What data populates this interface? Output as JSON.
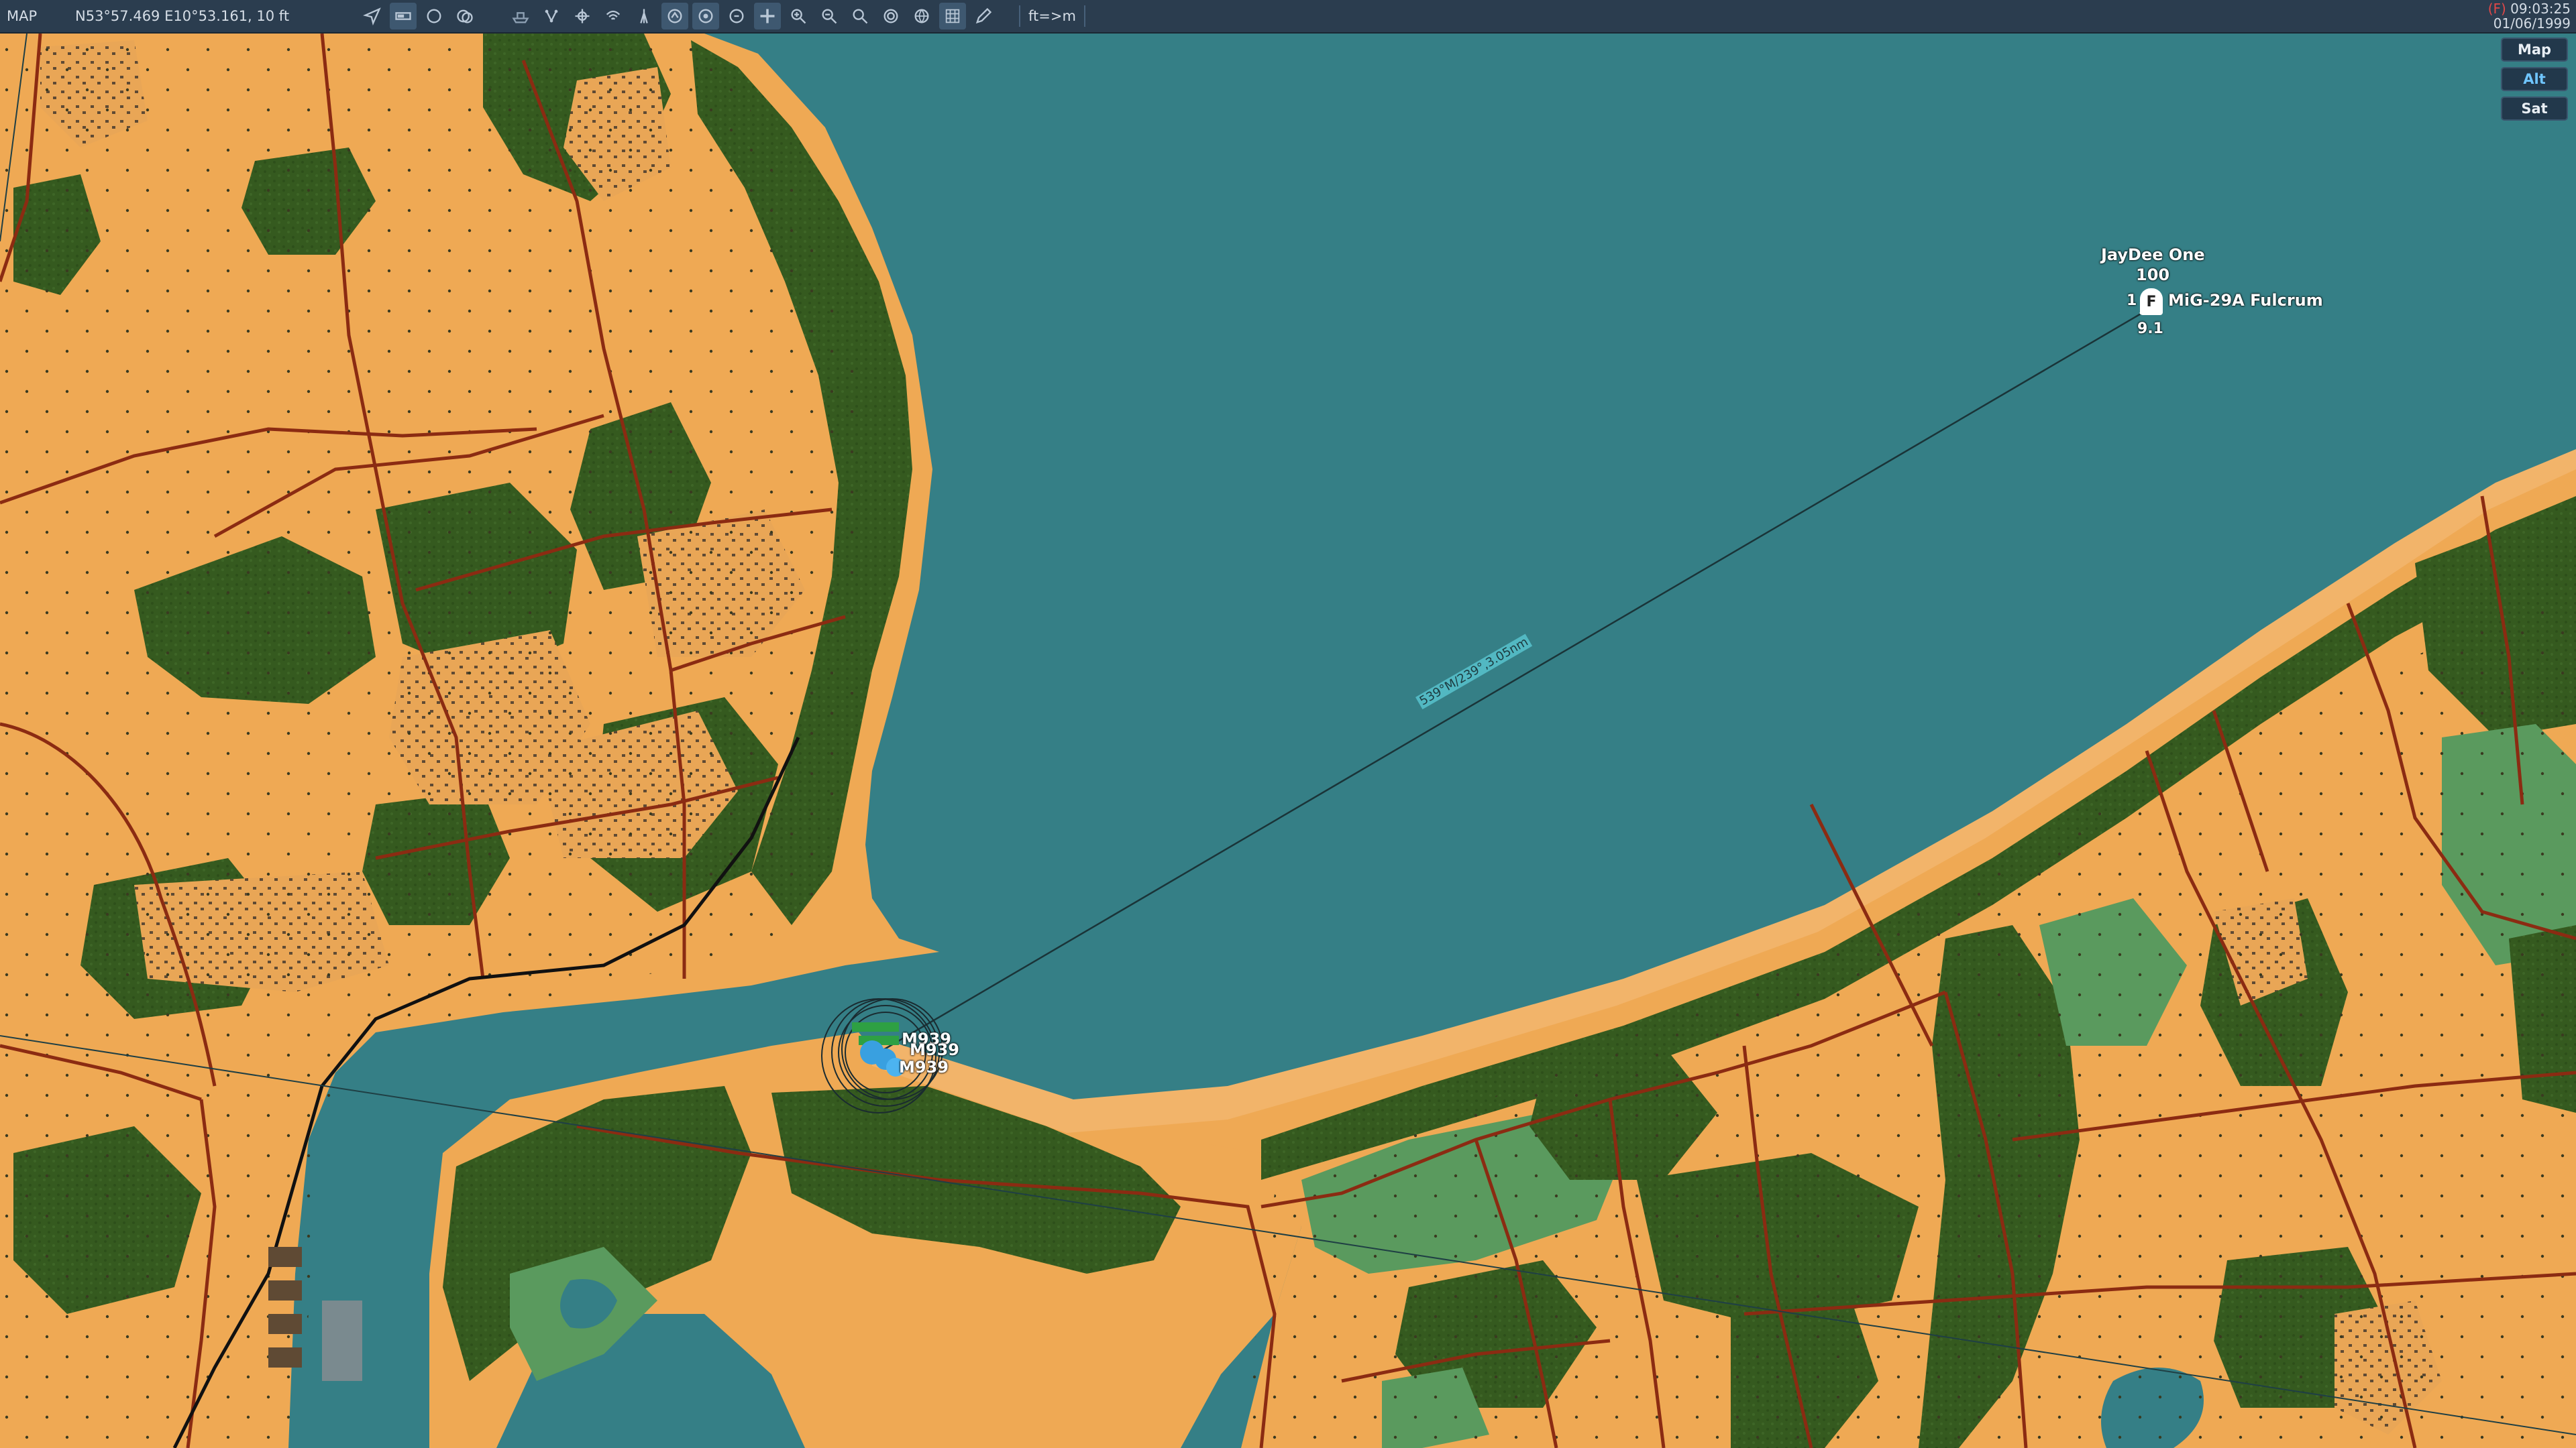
{
  "toolbar": {
    "mode": "MAP",
    "coords": "N53°57.469 E10°53.161, 10 ft",
    "units_toggle": "ft=>m",
    "clock_flag": "(F)",
    "clock_time": "09:03:25",
    "clock_date": "01/06/1999",
    "icons": [
      "navigate-icon",
      "ruler-icon",
      "circle-icon",
      "layers-icon",
      "ship-icon",
      "waypoint-icon",
      "target-icon",
      "signal-icon",
      "tower-icon",
      "track-icon",
      "track-alt-icon",
      "track-unit-icon",
      "center-icon",
      "zoom-in-icon",
      "zoom-out-icon",
      "zoom-fit-icon",
      "compass-icon",
      "globe-icon",
      "grid-icon",
      "pencil-icon"
    ]
  },
  "layers": {
    "map": "Map",
    "alt": "Alt",
    "sat": "Sat"
  },
  "aircraft": {
    "name": "JayDee One",
    "altitude": "100",
    "count": "1",
    "symbol": "F",
    "type": "MiG-29A Fulcrum",
    "speed": "9.1"
  },
  "measure_label": "539°M/239°,3.05nm",
  "ground_units": {
    "labels": [
      "M939",
      "M939",
      "M939"
    ]
  },
  "colors": {
    "water": "#357f86",
    "land": "#efa954",
    "forest": "#365b20",
    "meadow": "#5a9a5e",
    "road": "#8b2b12",
    "toolbar": "#2b3d4f"
  }
}
